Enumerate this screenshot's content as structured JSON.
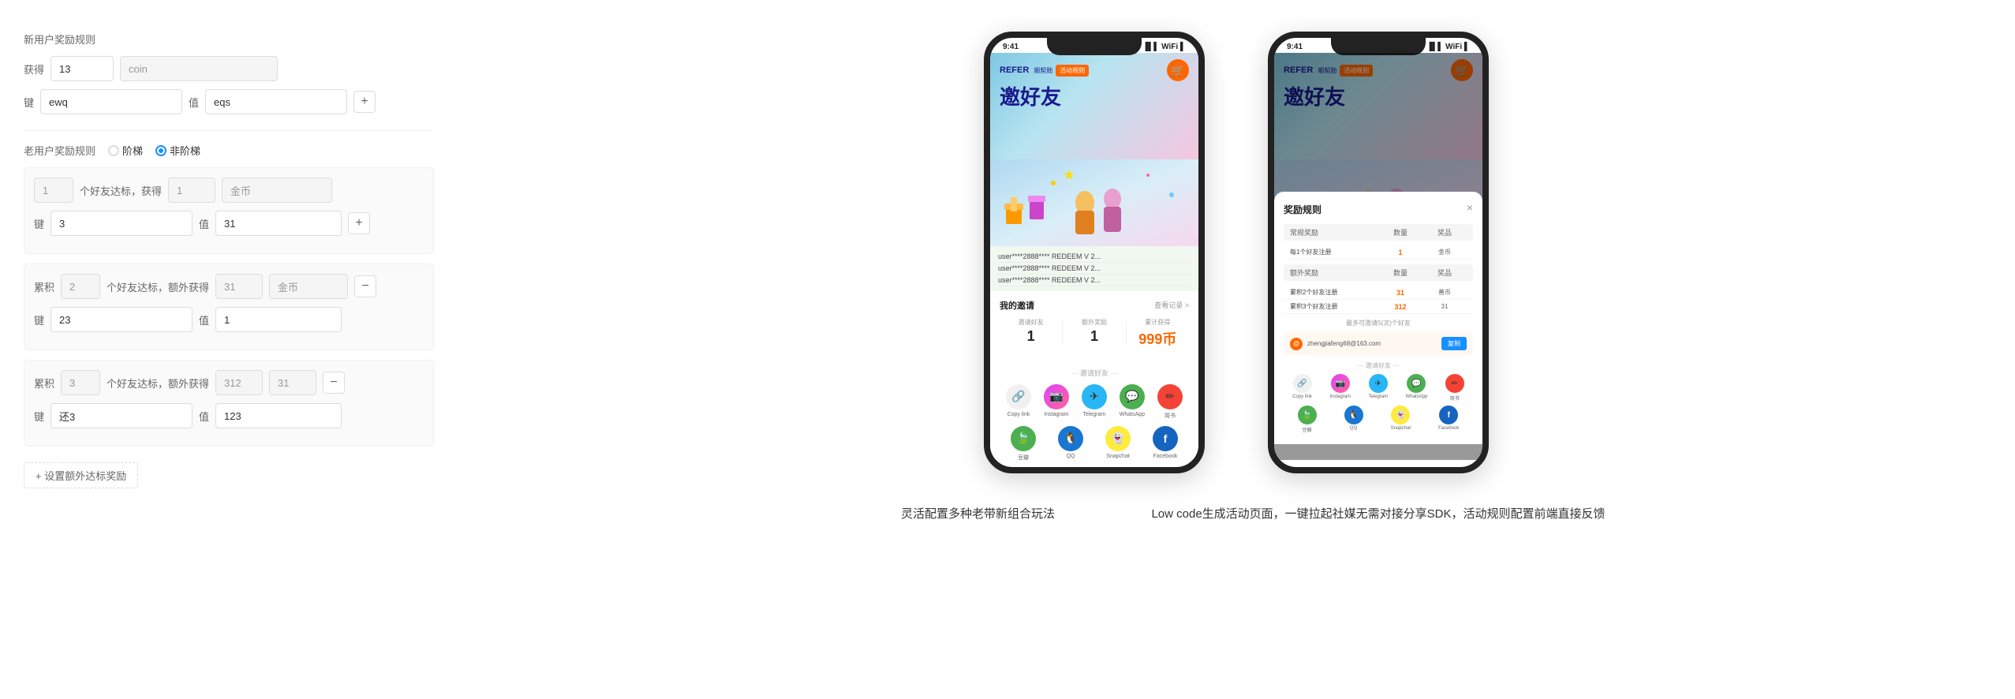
{
  "left": {
    "new_user_title": "新用户奖励规则",
    "obtain_label": "获得",
    "new_reward_amount": "13",
    "new_reward_unit": "coin",
    "key_label": "键",
    "value_label": "值",
    "new_key": "ewq",
    "new_value": "eqs",
    "old_user_title": "老用户奖励规则",
    "radio_option1": "阶梯",
    "radio_option2": "非阶梯",
    "old_reward_blocks": [
      {
        "prefix": "1",
        "mid_label": "个好友达标，获得",
        "amount": "1",
        "unit": "金币",
        "key": "3",
        "value": "31",
        "type": "normal"
      },
      {
        "prefix": "累积",
        "prefix_num": "2",
        "mid_label": "个好友达标，额外获得",
        "amount": "31",
        "unit": "金币",
        "key": "23",
        "value": "1",
        "type": "cumulative"
      },
      {
        "prefix": "累积",
        "prefix_num": "3",
        "mid_label": "个好友达标，额外获得",
        "amount": "312",
        "unit": "31",
        "key": "还3",
        "value": "123",
        "type": "cumulative"
      }
    ],
    "add_extra_btn": "+ 设置额外达标奖励"
  },
  "phones": {
    "phone1": {
      "time": "9:41",
      "refer_text": "REFER",
      "huijiao_text": "顺契勋",
      "activity_badge": "活动规则",
      "invite_title": "邀好友",
      "redeem_items": [
        "user****2888**** REDEEM V 2...",
        "user****2888**** REDEEM V 2...",
        "user****2888**** REDEEM V 2..."
      ],
      "my_invite": "我的邀请",
      "more_records": "查看记录 >",
      "stat_labels": [
        "邀请好友",
        "额外奖励",
        "累计获得"
      ],
      "stat_values": [
        "1",
        "1",
        "999币"
      ],
      "share_dots": "··· 邀请好友 ···",
      "share_items": [
        {
          "label": "Copy link",
          "color": "#f0f0f0",
          "icon": "🔗"
        },
        {
          "label": "Instagram",
          "color": "#e040fb",
          "icon": "📷"
        },
        {
          "label": "Telegram",
          "color": "#29b6f6",
          "icon": "✈"
        },
        {
          "label": "WhatsApp",
          "color": "#4caf50",
          "icon": "💬"
        },
        {
          "label": "简书",
          "color": "#f44336",
          "icon": "✏"
        }
      ],
      "share_items2": [
        {
          "label": "豆瓣",
          "color": "#4caf50",
          "icon": "🍃"
        },
        {
          "label": "QQ",
          "color": "#1976d2",
          "icon": "🐧"
        },
        {
          "label": "Snapchat",
          "color": "#ffeb3b",
          "icon": "👻"
        },
        {
          "label": "Facebook",
          "color": "#1565c0",
          "icon": "f"
        }
      ]
    },
    "phone2": {
      "time": "9:41",
      "refer_text": "REFER",
      "huijiao_text": "顺契勋",
      "activity_badge": "活动规则",
      "invite_title": "邀好友",
      "modal_title": "奖励规则",
      "modal_close": "×",
      "table_headers": [
        "常规奖励",
        "数量",
        "奖品"
      ],
      "normal_section": "常规奖励",
      "extra_section": "额外奖励",
      "normal_rows": [
        {
          "label": "每1个好友注册",
          "num": "1",
          "reward": "金币"
        }
      ],
      "extra_rows": [
        {
          "label": "累积2个好友注册",
          "num": "31",
          "reward": "善币"
        },
        {
          "label": "累积3个好友注册",
          "num": "312",
          "reward": "31"
        }
      ],
      "max_text": "最多可邀请5(次)个好友",
      "email_placeholder": "zhengjiafeng68@163.com",
      "copy_btn": "复制",
      "share_dots": "··· 邀请好友 ···",
      "share_items": [
        {
          "label": "Copy link",
          "color": "#f0f0f0",
          "icon": "🔗"
        },
        {
          "label": "Instagram",
          "color": "#e040fb",
          "icon": "📷"
        },
        {
          "label": "Telegram",
          "color": "#29b6f6",
          "icon": "✈"
        },
        {
          "label": "WhatsApp",
          "color": "#4caf50",
          "icon": "💬"
        },
        {
          "label": "简书",
          "color": "#f44336",
          "icon": "✏"
        }
      ],
      "share_items2": [
        {
          "label": "豆瓣",
          "color": "#4caf50",
          "icon": "🍃"
        },
        {
          "label": "QQ",
          "color": "#1976d2",
          "icon": "🐧"
        },
        {
          "label": "Snapchat",
          "color": "#ffeb3b",
          "icon": "👻"
        },
        {
          "label": "Facebook",
          "color": "#1565c0",
          "icon": "f"
        }
      ]
    }
  },
  "captions": {
    "left": "灵活配置多种老带新组合玩法",
    "right": "Low code生成活动页面，一键拉起社媒无需对接分享SDK，活动规则配置前端直接反馈"
  }
}
